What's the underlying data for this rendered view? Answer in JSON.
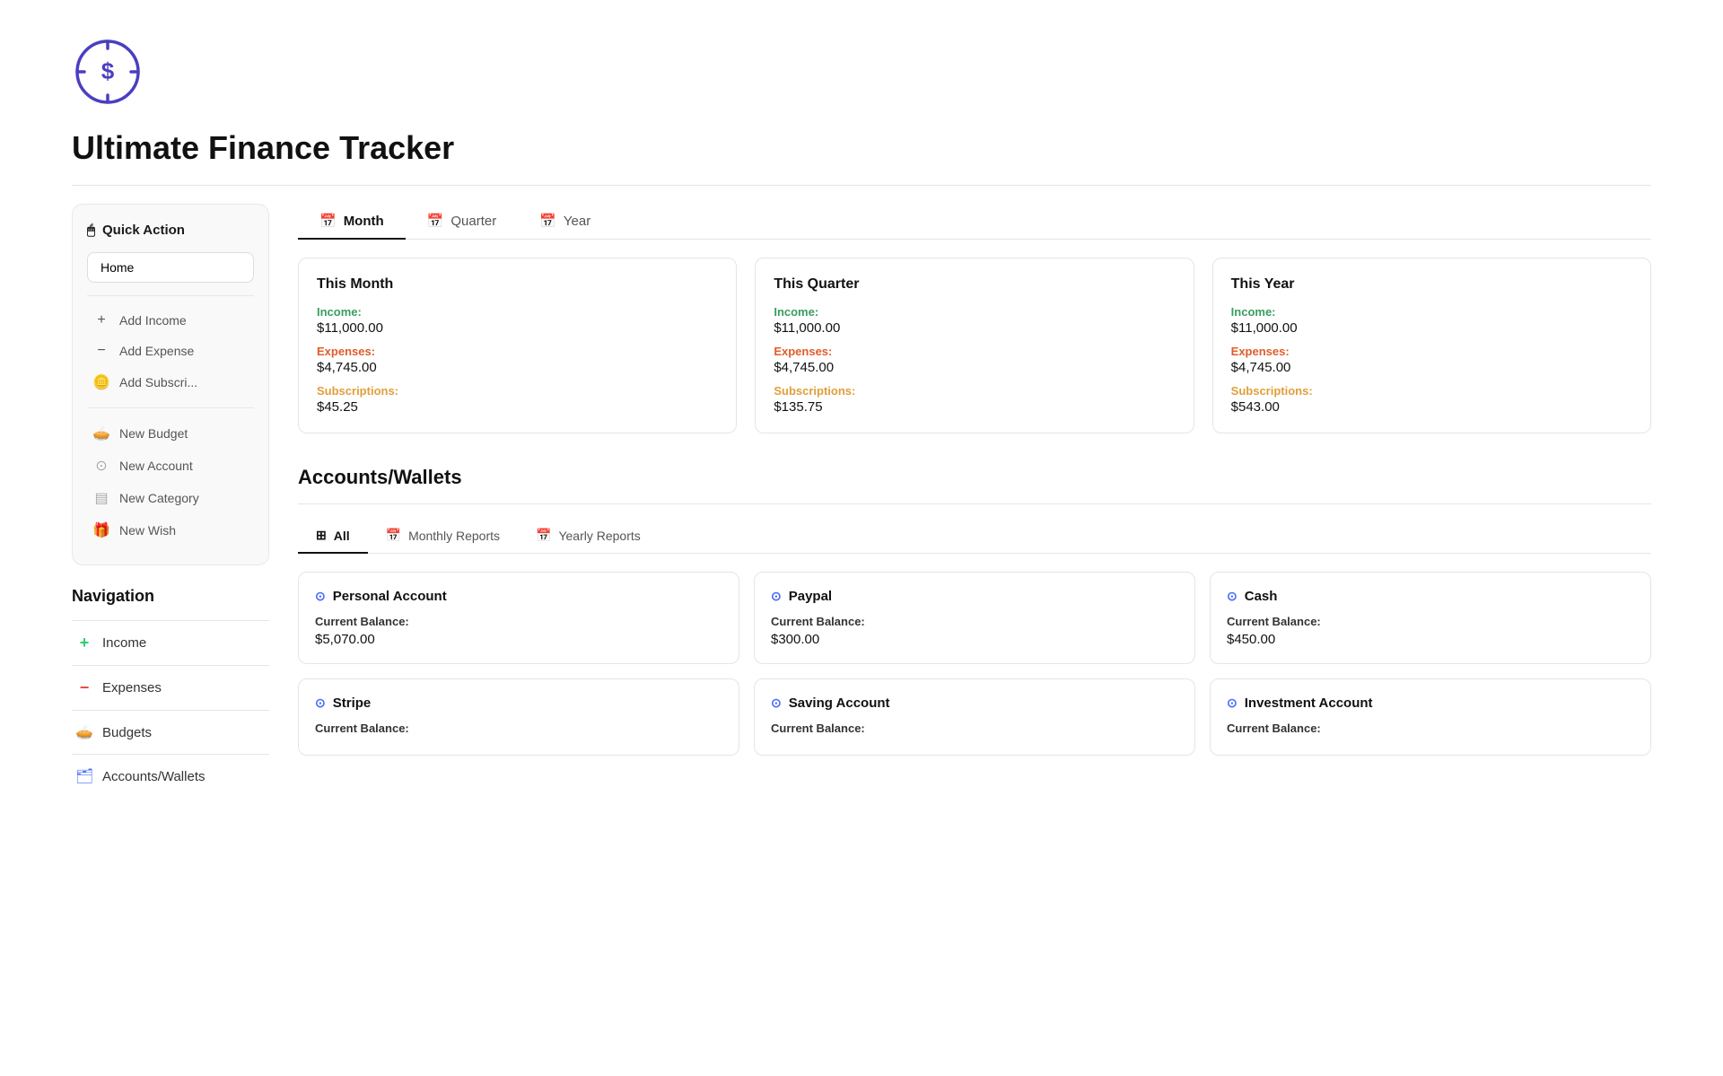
{
  "app": {
    "title": "Ultimate Finance Tracker"
  },
  "quick_action": {
    "header": "Quick Action",
    "home_label": "Home",
    "items": [
      {
        "id": "add-income",
        "icon": "+",
        "label": "Add Income"
      },
      {
        "id": "add-expense",
        "icon": "−",
        "label": "Add Expense"
      },
      {
        "id": "add-subscription",
        "icon": "💳",
        "label": "Add Subscri..."
      },
      {
        "id": "new-budget",
        "icon": "🥧",
        "label": "New Budget"
      },
      {
        "id": "new-account",
        "icon": "⚙",
        "label": "New Account"
      },
      {
        "id": "new-category",
        "icon": "📋",
        "label": "New Category"
      },
      {
        "id": "new-wish",
        "icon": "🎁",
        "label": "New Wish"
      }
    ]
  },
  "navigation": {
    "title": "Navigation",
    "items": [
      {
        "id": "income",
        "icon": "+",
        "icon_color": "#2ecc71",
        "label": "Income"
      },
      {
        "id": "expenses",
        "icon": "−",
        "icon_color": "#e74c3c",
        "label": "Expenses"
      },
      {
        "id": "budgets",
        "icon": "🥧",
        "icon_color": "#e74c3c",
        "label": "Budgets"
      },
      {
        "id": "accounts",
        "icon": "🗂",
        "icon_color": "#4a6cf7",
        "label": "Accounts/Wallets"
      }
    ]
  },
  "period_tabs": [
    {
      "id": "month",
      "icon": "📅",
      "label": "Month",
      "active": true
    },
    {
      "id": "quarter",
      "icon": "📅",
      "label": "Quarter",
      "active": false
    },
    {
      "id": "year",
      "icon": "📅",
      "label": "Year",
      "active": false
    }
  ],
  "summary_cards": [
    {
      "id": "this-month",
      "title": "This Month",
      "income_label": "Income:",
      "income_value": "$11,000.00",
      "expense_label": "Expenses:",
      "expense_value": "$4,745.00",
      "subscription_label": "Subscriptions:",
      "subscription_value": "$45.25"
    },
    {
      "id": "this-quarter",
      "title": "This Quarter",
      "income_label": "Income:",
      "income_value": "$11,000.00",
      "expense_label": "Expenses:",
      "expense_value": "$4,745.00",
      "subscription_label": "Subscriptions:",
      "subscription_value": "$135.75"
    },
    {
      "id": "this-year",
      "title": "This Year",
      "income_label": "Income:",
      "income_value": "$11,000.00",
      "expense_label": "Expenses:",
      "expense_value": "$4,745.00",
      "subscription_label": "Subscriptions:",
      "subscription_value": "$543.00"
    }
  ],
  "accounts_section": {
    "title": "Accounts/Wallets",
    "tabs": [
      {
        "id": "all",
        "icon": "⊞",
        "label": "All",
        "active": true
      },
      {
        "id": "monthly-reports",
        "icon": "📅",
        "label": "Monthly Reports",
        "active": false
      },
      {
        "id": "yearly-reports",
        "icon": "📅",
        "label": "Yearly Reports",
        "active": false
      }
    ],
    "accounts": [
      {
        "id": "personal-account",
        "name": "Personal Account",
        "balance_label": "Current Balance:",
        "balance_value": "$5,070.00"
      },
      {
        "id": "paypal",
        "name": "Paypal",
        "balance_label": "Current Balance:",
        "balance_value": "$300.00"
      },
      {
        "id": "cash",
        "name": "Cash",
        "balance_label": "Current Balance:",
        "balance_value": "$450.00"
      },
      {
        "id": "stripe",
        "name": "Stripe",
        "balance_label": "Current Balance:",
        "balance_value": ""
      },
      {
        "id": "saving-account",
        "name": "Saving Account",
        "balance_label": "Current Balance:",
        "balance_value": ""
      },
      {
        "id": "investment-account",
        "name": "Investment Account",
        "balance_label": "Current Balance:",
        "balance_value": ""
      }
    ]
  }
}
